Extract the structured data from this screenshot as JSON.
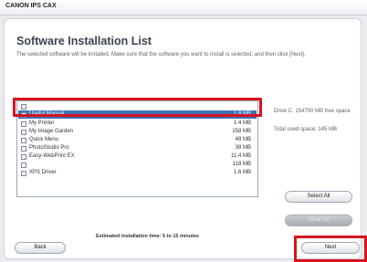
{
  "window": {
    "title": "CANON IPS CAX"
  },
  "heading": "Software Installation List",
  "description": "The selected software will be installed. Make sure that the software you want to install is selected, and then click [Next].",
  "items": [
    {
      "name": "",
      "size": "",
      "selected": false
    },
    {
      "name": "Useful Manual",
      "size": "1.8 MB",
      "selected": true
    },
    {
      "name": "My Printer",
      "size": "1.4 MB",
      "selected": false
    },
    {
      "name": "My Image Garden",
      "size": "158 MB",
      "selected": false
    },
    {
      "name": "Quick Menu",
      "size": "48 MB",
      "selected": false
    },
    {
      "name": "PhotoStudio Pro",
      "size": "38 MB",
      "selected": false
    },
    {
      "name": "Easy-WebPrint EX",
      "size": "11.4 MB",
      "selected": false
    },
    {
      "name": "",
      "size": "118 MB",
      "selected": false
    },
    {
      "name": "XPS Driver",
      "size": "1.6 MB",
      "selected": false
    }
  ],
  "disk": {
    "free": "Drive C: 154700 MB free space",
    "total": "Total used space: 145 MB"
  },
  "buttons": {
    "select_all": "Select All",
    "clear_all": "Clear All",
    "back": "Back",
    "next": "Next"
  },
  "footer_note": "Estimated installation time: 5 to 15 minutes"
}
